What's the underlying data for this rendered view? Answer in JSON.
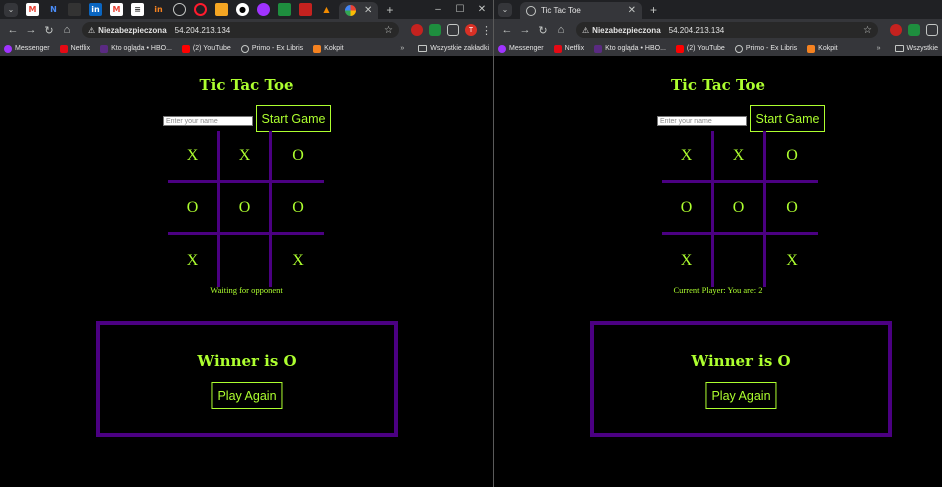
{
  "colors": {
    "accent": "#adff2f",
    "grid": "#4b0082",
    "background": "#000000",
    "chrome_bg": "#35363a"
  },
  "left": {
    "tabs": [
      "gmail-icon",
      "n-icon",
      "linkedin-icon",
      "gmail-icon",
      "doc-icon",
      "kokpit-icon",
      "circle-icon",
      "opera-icon",
      "orange-icon",
      "github-icon",
      "messenger-icon",
      "sheets-icon",
      "red-icon",
      "vlc-icon",
      "chrome-icon"
    ],
    "tab_close": "✕",
    "new_tab": "+",
    "window_controls": {
      "minimize": "–",
      "maximize": "☐",
      "close": "✕"
    },
    "toolbar": {
      "insecure_label": "Niezabezpieczona",
      "url": "54.204.213.134"
    },
    "bookmarks": [
      "Messenger",
      "Netflix",
      "Kto ogląda • HBO...",
      "(2) YouTube",
      "Primo - Ex Libris",
      "Kokpit"
    ],
    "bookmarks_more": "»",
    "bookmarks_folder": "Wszystkie zakładki",
    "app": {
      "title": "Tic Tac Toe",
      "name_placeholder": "Enter your name",
      "start_label": "Start Game",
      "board": [
        "X",
        "X",
        "O",
        "O",
        "O",
        "O",
        "X",
        "",
        "X"
      ],
      "status": "Waiting for opponent",
      "winner": "Winner is O",
      "play_again": "Play Again"
    }
  },
  "right": {
    "tab_title": "Tic Tac Toe",
    "tab_close": "✕",
    "new_tab": "+",
    "toolbar": {
      "insecure_label": "Niezabezpieczona",
      "url": "54.204.213.134"
    },
    "bookmarks": [
      "Messenger",
      "Netflix",
      "Kto ogląda • HBO...",
      "(2) YouTube",
      "Primo - Ex Libris",
      "Kokpit"
    ],
    "bookmarks_more": "»",
    "bookmarks_folder": "Wszystkie",
    "app": {
      "title": "Tic Tac Toe",
      "name_placeholder": "Enter your name",
      "start_label": "Start Game",
      "board": [
        "X",
        "X",
        "O",
        "O",
        "O",
        "O",
        "X",
        "",
        "X"
      ],
      "status": "Current Player: You are: 2",
      "winner": "Winner is O",
      "play_again": "Play Again"
    }
  }
}
